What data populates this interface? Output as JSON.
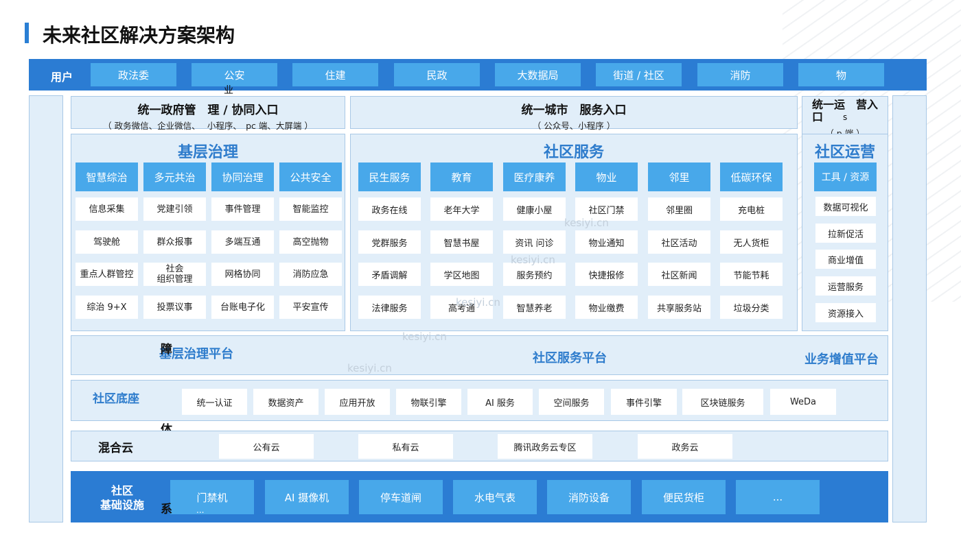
{
  "title": "未来社区解决方案架构",
  "users": {
    "label": "用户",
    "items": [
      "政法委",
      "公安",
      "住建",
      "民政",
      "大数据局",
      "街道 / 社区",
      "消防",
      "物"
    ]
  },
  "stray": {
    "ye": "业",
    "zhang": "障",
    "ti": "体",
    "xi": "系",
    "dots": "...",
    "s": "s",
    "qi": "企"
  },
  "entries": {
    "gov": {
      "title": "统一政府管　理 / 协同入口",
      "sub": "（ 政务微信、企业微信、　 小程序、　pc 端、大屏端 ）"
    },
    "city": {
      "title": "统一城市　服务入口",
      "sub": "（ 公众号、小程序 ）"
    },
    "ops": {
      "title": "统一运　营入口",
      "sub": "（ p  端 ）"
    }
  },
  "governance": {
    "title": "基层治理",
    "columns": [
      {
        "head": "智慧综治",
        "items": [
          "信息采集",
          "驾驶舱",
          "重点人群管控",
          "综治 9+X"
        ]
      },
      {
        "head": "多元共治",
        "items": [
          "党建引领",
          "群众报事",
          "社会\n组织管理",
          "投票议事"
        ]
      },
      {
        "head": "协同治理",
        "items": [
          "事件管理",
          "多端互通",
          "网格协同",
          "台账电子化"
        ]
      },
      {
        "head": "公共安全",
        "items": [
          "智能监控",
          "高空抛物",
          "消防应急",
          "平安宣传"
        ]
      }
    ]
  },
  "services": {
    "title": "社区服务",
    "columns": [
      {
        "head": "民生服务",
        "items": [
          "政务在线",
          "党群服务",
          "矛盾调解",
          "法律服务"
        ]
      },
      {
        "head": "教育",
        "items": [
          "老年大学",
          "智慧书屋",
          "学区地图",
          "高考通"
        ]
      },
      {
        "head": "医疗康养",
        "items": [
          "健康小屋",
          "资讯 问诊",
          "服务预约",
          "智慧养老"
        ]
      },
      {
        "head": "物业",
        "items": [
          "社区门禁",
          "物业通知",
          "快捷报修",
          "物业缴费"
        ]
      },
      {
        "head": "邻里",
        "items": [
          "邻里圈",
          "社区活动",
          "社区新闻",
          "共享服务站"
        ]
      },
      {
        "head": "低碳环保",
        "items": [
          "充电桩",
          "无人货柜",
          "节能节耗",
          "垃圾分类"
        ]
      }
    ]
  },
  "operations": {
    "title": "社区运营",
    "head": "工具 / 资源",
    "items": [
      "数据可视化",
      "拉新促活",
      "商业增值",
      "运营服务",
      "资源接入"
    ]
  },
  "platforms": [
    "基层治理平台",
    "社区服务平台",
    "业务增值平台"
  ],
  "base": {
    "label": "社区底座",
    "items": [
      "统一认证",
      "数据资产",
      "应用开放",
      "物联引擎",
      "AI  服务",
      "空间服务",
      "事件引擎",
      "区块链服务",
      "WeDa"
    ]
  },
  "cloud": {
    "label": "混合云",
    "items": [
      "公有云",
      "私有云",
      "腾讯政务云专区",
      "政务云"
    ]
  },
  "infra": {
    "label": "社区\n基础设施",
    "items": [
      "门禁机",
      "AI 摄像机",
      "停车道闸",
      "水电气表",
      "消防设备",
      "便民货柜",
      "..."
    ]
  },
  "watermark": "kesiyi.cn",
  "colors": {
    "primary": "#2b7cd3",
    "accent": "#48a8ea",
    "panel": "#e1eef9",
    "title_blue": "#2e7ccc"
  }
}
